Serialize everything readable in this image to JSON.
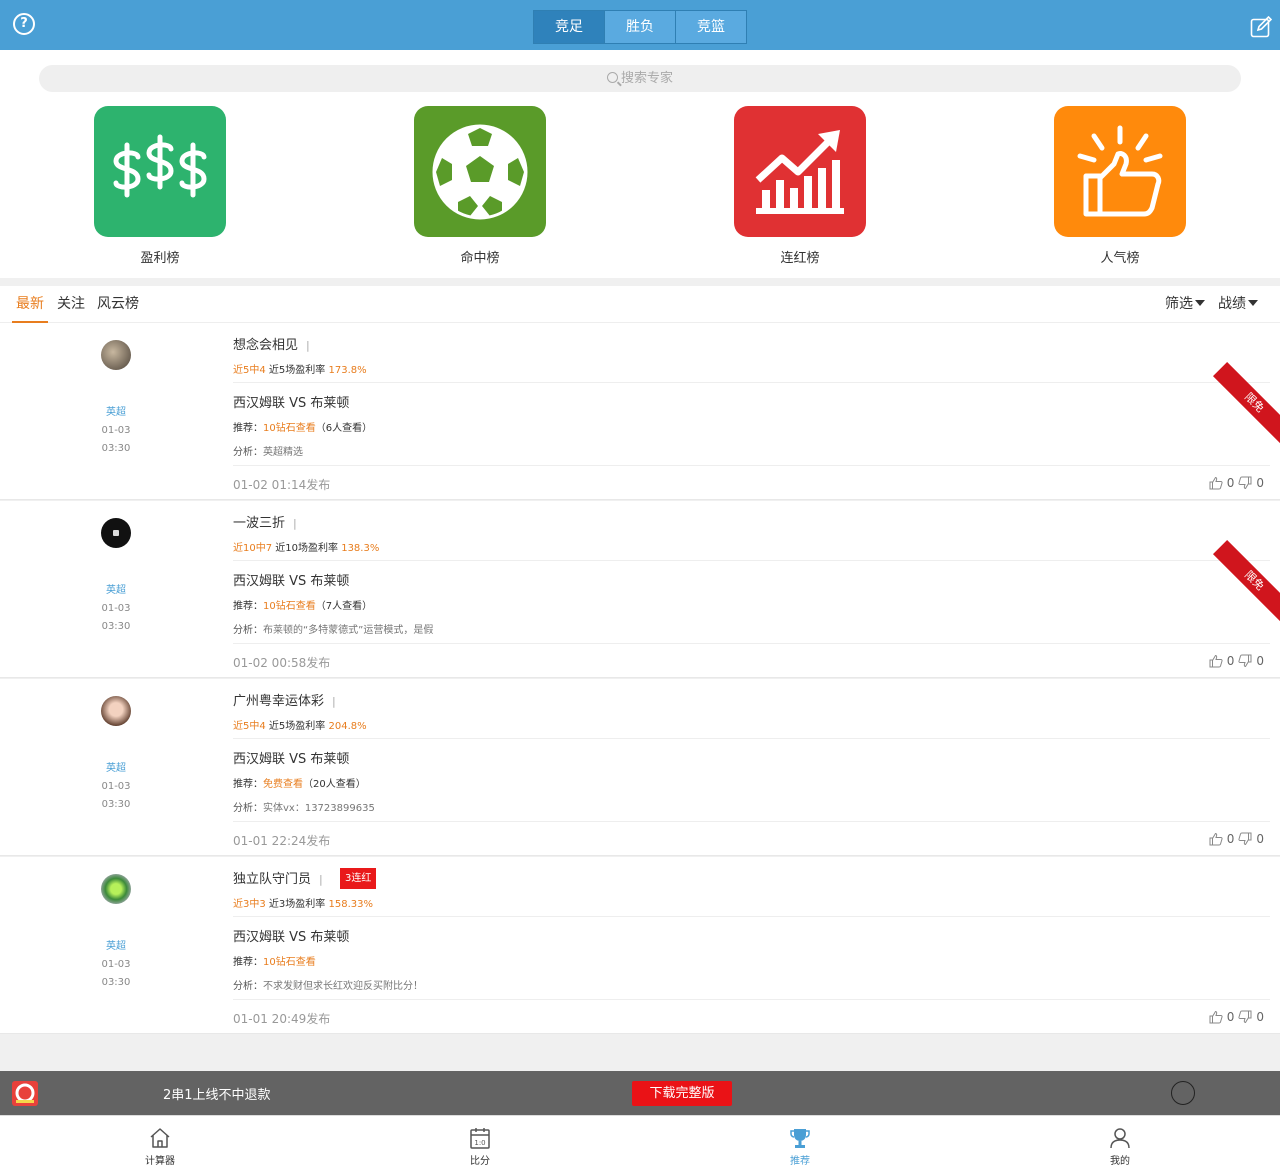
{
  "header": {
    "segments": [
      "竞足",
      "胜负",
      "竞篮"
    ],
    "active_segment": "竞足"
  },
  "search": {
    "placeholder": "搜索专家"
  },
  "rankings": [
    {
      "label": "盈利榜",
      "color": "#2db36e",
      "icon": "dollar-signs-icon"
    },
    {
      "label": "命中榜",
      "color": "#5a9b29",
      "icon": "soccer-ball-icon"
    },
    {
      "label": "连红榜",
      "color": "#e03133",
      "icon": "rising-chart-icon"
    },
    {
      "label": "人气榜",
      "color": "#ff8a0c",
      "icon": "thumbs-up-icon"
    }
  ],
  "tabs": [
    "最新",
    "关注",
    "风云榜"
  ],
  "filters": {
    "filter": "筛选",
    "record": "战绩"
  },
  "cards": [
    {
      "league": "英超",
      "date": "01-03",
      "time": "03:30",
      "name": "想念会相见",
      "sep": "|",
      "stat_hit": "近5中4",
      "stat_label": "近5场盈利率",
      "stat_rate": "173.8%",
      "match": "西汉姆联 VS 布莱顿",
      "rec_label": "推荐：",
      "rec_value": "10钻石查看",
      "rec_views": "（6人查看）",
      "ana_label": "分析：",
      "ana_text": "英超精选",
      "published": "01-02 01:14发布",
      "up": "0",
      "down": "0",
      "ribbon": "限免"
    },
    {
      "league": "英超",
      "date": "01-03",
      "time": "03:30",
      "name": "一波三折",
      "sep": "|",
      "stat_hit": "近10中7",
      "stat_label": "近10场盈利率",
      "stat_rate": "138.3%",
      "match": "西汉姆联 VS 布莱顿",
      "rec_label": "推荐：",
      "rec_value": "10钻石查看",
      "rec_views": "（7人查看）",
      "ana_label": "分析：",
      "ana_text": "布莱顿的“多特蒙德式”运营模式，是假",
      "published": "01-02 00:58发布",
      "up": "0",
      "down": "0",
      "ribbon": "限免"
    },
    {
      "league": "英超",
      "date": "01-03",
      "time": "03:30",
      "name": "广州粤幸运体彩",
      "sep": "|",
      "stat_hit": "近5中4",
      "stat_label": "近5场盈利率",
      "stat_rate": "204.8%",
      "match": "西汉姆联 VS 布莱顿",
      "rec_label": "推荐：",
      "rec_value": "免费查看",
      "rec_views": "（20人查看）",
      "ana_label": "分析：",
      "ana_text": "实体vx：13723899635",
      "published": "01-01 22:24发布",
      "up": "0",
      "down": "0"
    },
    {
      "league": "英超",
      "date": "01-03",
      "time": "03:30",
      "name": "独立队守门员",
      "sep": "|",
      "streak": "3连红",
      "stat_hit": "近3中3",
      "stat_label": "近3场盈利率",
      "stat_rate": "158.33%",
      "match": "西汉姆联 VS 布莱顿",
      "rec_label": "推荐：",
      "rec_value": "10钻石查看",
      "rec_views": "",
      "ana_label": "分析：",
      "ana_text": "不求发财但求长红欢迎反买附比分！",
      "published": "01-01 20:49发布",
      "up": "0",
      "down": "0"
    }
  ],
  "promo": {
    "text": "2串1上线不中退款",
    "button": "下载完整版"
  },
  "bottom_nav": [
    {
      "label": "计算器",
      "icon": "home-icon"
    },
    {
      "label": "比分",
      "icon": "calendar-score-icon",
      "badge": "1:0"
    },
    {
      "label": "推荐",
      "icon": "trophy-icon",
      "active": true
    },
    {
      "label": "我的",
      "icon": "user-icon"
    }
  ]
}
